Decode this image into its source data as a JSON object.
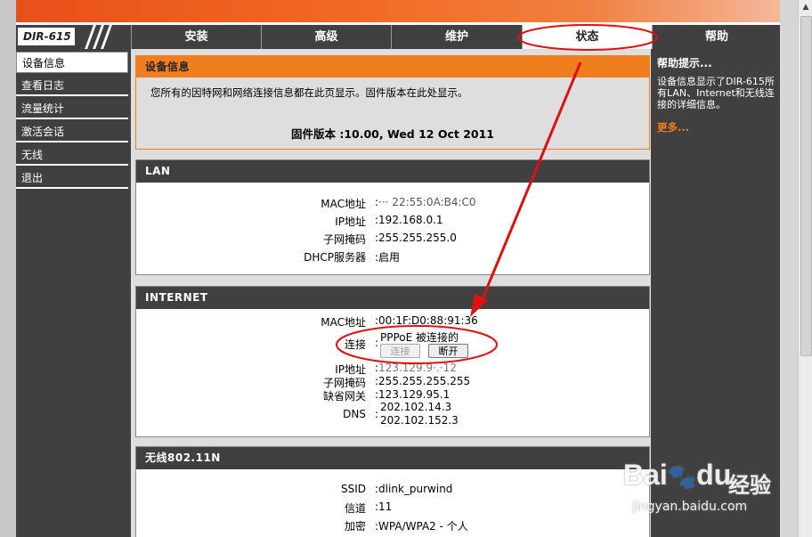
{
  "brand": {
    "model_label": "DIR-615"
  },
  "nav": {
    "tabs": [
      {
        "label": "安装"
      },
      {
        "label": "高级"
      },
      {
        "label": "维护"
      },
      {
        "label": "状态"
      },
      {
        "label": "帮助"
      }
    ],
    "active_index": 3
  },
  "sidebar": {
    "items": [
      {
        "label": "设备信息"
      },
      {
        "label": "查看日志"
      },
      {
        "label": "流量统计"
      },
      {
        "label": "激活会话"
      },
      {
        "label": "无线"
      },
      {
        "label": "退出"
      }
    ],
    "active_index": 0
  },
  "device_info": {
    "title": "设备信息",
    "description": "您所有的因特网和网络连接信息都在此页显示。固件版本在此处显示。",
    "firmware_label": "固件版本 :",
    "firmware_value": "10.00,  Wed 12 Oct 2011"
  },
  "lan": {
    "title": "LAN",
    "rows": [
      {
        "label": "MAC地址",
        "value": "··· 22:55:0A:B4:C0"
      },
      {
        "label": "IP地址",
        "value": "192.168.0.1"
      },
      {
        "label": "子网掩码",
        "value": "255.255.255.0"
      },
      {
        "label": "DHCP服务器",
        "value": "启用"
      }
    ]
  },
  "internet": {
    "title": "INTERNET",
    "mac_label": "MAC地址",
    "mac_value": "00:1F:D0:88:91:36",
    "conn_label": "连接",
    "conn_value": "PPPoE 被连接的",
    "connect_button": "连接",
    "disconnect_button": "断开",
    "ip_label": "IP地址",
    "ip_value": "123.129.9·.·12",
    "mask_label": "子网掩码",
    "mask_value": "255.255.255.255",
    "gateway_label": "缺省网关",
    "gateway_value": "123.129.95.1",
    "dns_label": "DNS",
    "dns_values": [
      "202.102.14.3",
      "202.102.152.3"
    ]
  },
  "wireless": {
    "title": "无线802.11N",
    "rows": [
      {
        "label": "SSID",
        "value": "dlink_purwind"
      },
      {
        "label": "信道",
        "value": "11"
      },
      {
        "label": "加密",
        "value": "WPA/WPA2 - 个人"
      }
    ]
  },
  "help": {
    "title": "帮助提示...",
    "text": "设备信息显示了DIR-615所有LAN、Internet和无线连接的详细信息。",
    "more": "更多..."
  },
  "watermark": {
    "brand": "Bai",
    "brand_suffix": "du",
    "text": "经验",
    "url": "jingyan.baidu.com"
  },
  "colors": {
    "accent_orange": "#f07d1e",
    "dark_gray": "#404040",
    "annotation_red": "#e01010"
  }
}
